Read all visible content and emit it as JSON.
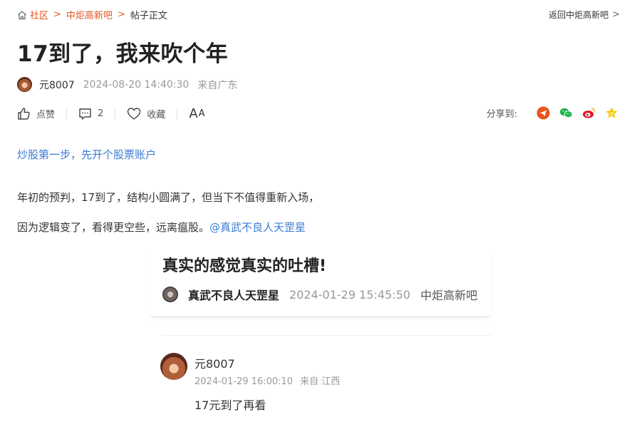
{
  "breadcrumb": {
    "home_label": "社区",
    "forum_label": "中炬高新吧",
    "current_label": "帖子正文",
    "separator": ">"
  },
  "back_link": {
    "label": "返回中炬高新吧",
    "chevron": ">"
  },
  "post": {
    "title": "17到了，我来吹个年",
    "author": "元8007",
    "time": "2024-08-20 14:40:30",
    "location": "来自广东"
  },
  "actions": {
    "like_label": "点赞",
    "comment_count": "2",
    "favorite_label": "收藏",
    "font_big": "A",
    "font_small": "A"
  },
  "share": {
    "label": "分享到:",
    "icons": [
      "telegram-share-icon",
      "wechat-icon",
      "weibo-icon",
      "star-icon"
    ]
  },
  "promo_link": "炒股第一步，先开个股票账户",
  "content": {
    "line1": "年初的预判，17到了，结构小圆满了，但当下不值得重新入场，",
    "line2_prefix": "因为逻辑变了，看得更空些，远离瘟股。",
    "mention": "@真武不良人天罡星"
  },
  "quoted_post": {
    "title": "真实的感觉真实的吐槽!",
    "author": "真武不良人天罡星",
    "time": "2024-01-29 15:45:50",
    "forum": "中炬高新吧"
  },
  "reply": {
    "author": "元8007",
    "time": "2024-01-29 16:00:10",
    "location": "来自 江西",
    "text": "17元到了再看"
  },
  "colors": {
    "accent": "#e8541e",
    "link": "#3a7bd5",
    "muted": "#999999"
  }
}
